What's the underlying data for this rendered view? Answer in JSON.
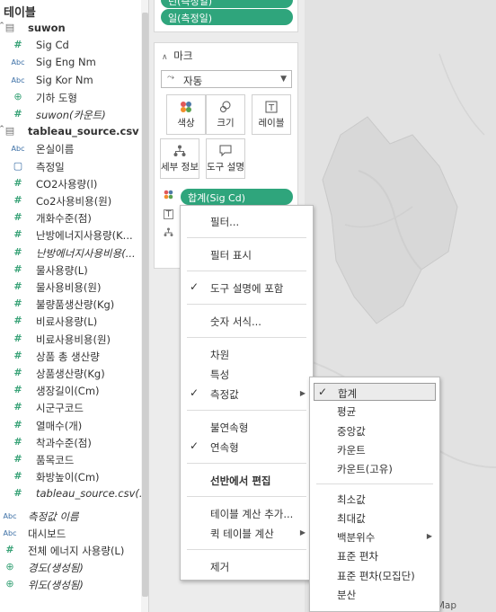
{
  "data_pane": {
    "title": "테이블",
    "sources": [
      {
        "name": "suwon",
        "fields": [
          {
            "icon": "hash",
            "name": "Sig Cd"
          },
          {
            "icon": "abc",
            "name": "Sig Eng Nm"
          },
          {
            "icon": "abc",
            "name": "Sig Kor Nm"
          },
          {
            "icon": "globe",
            "name": "기하 도형"
          },
          {
            "icon": "hash",
            "name": "suwon(카운트)"
          }
        ]
      },
      {
        "name": "tableau_source.csv",
        "fields": [
          {
            "icon": "abc",
            "name": "온실이름"
          },
          {
            "icon": "date",
            "name": "측정일"
          },
          {
            "icon": "hash",
            "name": "CO2사용량(l)"
          },
          {
            "icon": "hash",
            "name": "Co2사용비용(원)"
          },
          {
            "icon": "hash",
            "name": "개화수준(점)"
          },
          {
            "icon": "hash",
            "name": "난방에너지사용량(K..."
          },
          {
            "icon": "hash",
            "name": "난방에너지사용비용(..."
          },
          {
            "icon": "hash",
            "name": "물사용량(L)"
          },
          {
            "icon": "hash",
            "name": "물사용비용(원)"
          },
          {
            "icon": "hash",
            "name": "불량품생산량(Kg)"
          },
          {
            "icon": "hash",
            "name": "비료사용량(L)"
          },
          {
            "icon": "hash",
            "name": "비료사용비용(원)"
          },
          {
            "icon": "hash",
            "name": "상품 총 생산량"
          },
          {
            "icon": "hash",
            "name": "상품생산량(Kg)"
          },
          {
            "icon": "hash",
            "name": "생장길이(Cm)"
          },
          {
            "icon": "hash",
            "name": "시군구코드"
          },
          {
            "icon": "hash",
            "name": "열매수(개)"
          },
          {
            "icon": "hash",
            "name": "착과수준(점)"
          },
          {
            "icon": "hash",
            "name": "품목코드"
          },
          {
            "icon": "hash",
            "name": "화방높이(Cm)"
          },
          {
            "icon": "hash",
            "name": "tableau_source.csv(..."
          }
        ]
      }
    ],
    "extra_fields": [
      {
        "icon": "abc",
        "name": "측정값 이름"
      },
      {
        "icon": "abc",
        "name": "대시보드"
      },
      {
        "icon": "hash",
        "name": "전체 에너지 사용량(L)"
      },
      {
        "icon": "globe",
        "name": "경도(생성됨)"
      },
      {
        "icon": "globe",
        "name": "위도(생성됨)"
      }
    ]
  },
  "shelves": {
    "pill_top": "년(측정일)",
    "pill_second": "일(측정일)"
  },
  "marks": {
    "title": "마크",
    "mark_type": "자동",
    "buttons": [
      {
        "icon": "color-icon",
        "label": "색상"
      },
      {
        "icon": "size-icon",
        "label": "크기"
      },
      {
        "icon": "label-icon",
        "label": "레이블"
      },
      {
        "icon": "detail-icon",
        "label": "세부 정보"
      },
      {
        "icon": "tooltip-icon",
        "label": "도구 설명"
      }
    ],
    "color_pill": "합계(Sig Cd)"
  },
  "context_menu": {
    "items": [
      {
        "label": "필터...",
        "check": false,
        "submenu": false
      },
      {
        "sep": true
      },
      {
        "label": "필터 표시",
        "check": false,
        "submenu": false
      },
      {
        "sep": true
      },
      {
        "label": "도구 설명에 포함",
        "check": true,
        "submenu": false
      },
      {
        "sep": true
      },
      {
        "label": "숫자 서식...",
        "check": false,
        "submenu": false
      },
      {
        "sep": true
      },
      {
        "label": "차원",
        "check": false,
        "submenu": false
      },
      {
        "label": "특성",
        "check": false,
        "submenu": false
      },
      {
        "label": "측정값",
        "check": true,
        "submenu": true
      },
      {
        "sep": true
      },
      {
        "label": "불연속형",
        "check": false,
        "submenu": false
      },
      {
        "label": "연속형",
        "check": true,
        "submenu": false
      },
      {
        "sep": true
      },
      {
        "label": "선반에서 편집",
        "check": false,
        "submenu": false,
        "bold": true
      },
      {
        "sep": true
      },
      {
        "label": "테이블 계산 추가...",
        "check": false,
        "submenu": false
      },
      {
        "label": "퀵 테이블 계산",
        "check": false,
        "submenu": true
      },
      {
        "sep": true
      },
      {
        "label": "제거",
        "check": false,
        "submenu": false
      }
    ]
  },
  "aggregation_menu": {
    "items": [
      {
        "label": "합계",
        "check": true,
        "highlight": true
      },
      {
        "label": "평균"
      },
      {
        "label": "중앙값"
      },
      {
        "label": "카운트"
      },
      {
        "label": "카운트(고유)"
      },
      {
        "sep": true
      },
      {
        "label": "최소값"
      },
      {
        "label": "최대값"
      },
      {
        "label": "백분위수",
        "submenu": true
      },
      {
        "label": "표준 편차"
      },
      {
        "label": "표준 편차(모집단)"
      },
      {
        "label": "분산"
      }
    ]
  },
  "map": {
    "attribution": "Map"
  }
}
